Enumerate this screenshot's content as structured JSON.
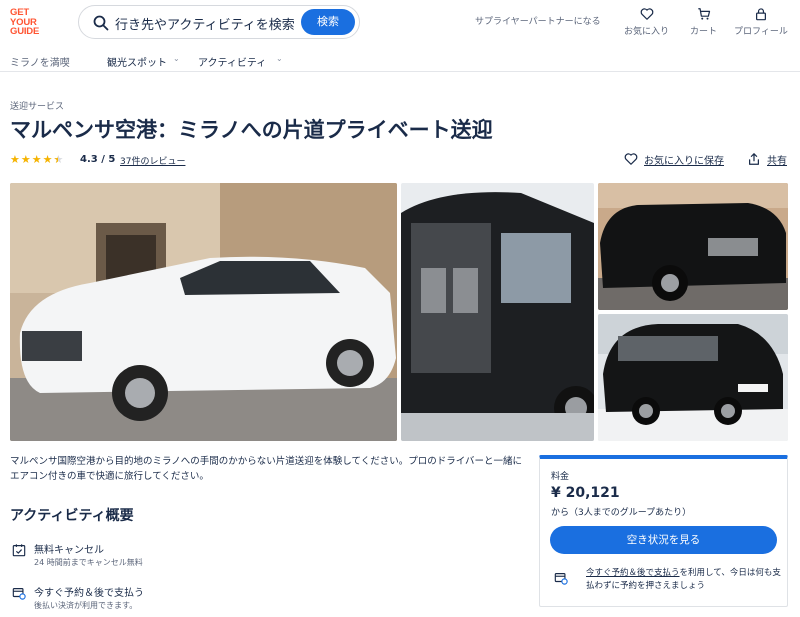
{
  "header": {
    "logo_lines": [
      "GET",
      "YOUR",
      "GUIDE"
    ],
    "search_placeholder": "行き先やアクティビティを検索",
    "search_button": "検索",
    "supplier_link": "サプライヤーパートナーになる",
    "icons": [
      {
        "name": "heart-icon",
        "label": "お気に入り"
      },
      {
        "name": "cart-icon",
        "label": "カート"
      },
      {
        "name": "profile-icon",
        "label": "プロフィール"
      }
    ]
  },
  "subnav": {
    "items": [
      "ミラノを満喫",
      "観光スポット",
      "アクティビティ"
    ]
  },
  "product": {
    "category": "送迎サービス",
    "title": "マルペンサ空港：ミラノへの片道プライベート送迎",
    "stars": 4.3,
    "rating_text": "4.3 / 5",
    "reviews_link": "37件のレビュー",
    "wishlist": "お気に入りに保存",
    "share": "共有",
    "description": "マルペンサ国際空港から目的地のミラノへの手間のかからない片道送迎を体験してください。プロのドライバーと一緒にエアコン付きの車で快適に旅行してください。",
    "overview_title": "アクティビティ概要",
    "features": [
      {
        "icon": "calendar-check-icon",
        "title": "無料キャンセル",
        "subtitle": "24 時間前までキャンセル無料"
      },
      {
        "icon": "reserve-pay-icon",
        "title": "今すぐ予約＆後で支払う",
        "subtitle": "後払い決済が利用できます。"
      }
    ]
  },
  "booking": {
    "label": "料金",
    "price": "¥ 20,121",
    "per": "から（3人までのグループあたり）",
    "cta": "空き状況を見る",
    "note_link": "今すぐ予約＆後で支払う",
    "note_rest": "を利用して、今日は何も支払わずに予約を押さえましょう"
  },
  "colors": {
    "brand": "#ff5533",
    "accent": "#1a6fe0",
    "text": "#1a2b49",
    "star": "#f5b301"
  }
}
